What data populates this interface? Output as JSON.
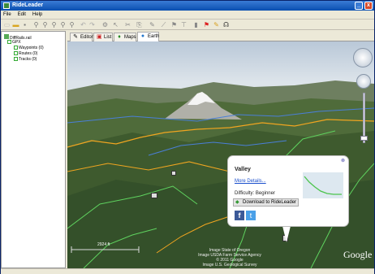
{
  "window": {
    "title": "RideLeader",
    "controls": [
      "_",
      "x"
    ]
  },
  "menu": [
    "File",
    "Edit",
    "Help"
  ],
  "toolbar_icons": [
    "new-icon",
    "open-icon",
    "save-icon",
    "zoom-in-icon",
    "zoom-out-icon",
    "zoom-fit-icon",
    "zoom-area-icon",
    "zoom-prev-icon",
    "undo-icon",
    "redo-icon",
    "gear-icon",
    "pointer-icon",
    "cut-icon",
    "copy-icon",
    "pencil-icon",
    "route-icon",
    "flag-icon",
    "pin-icon",
    "delete-icon",
    "red-flag-icon",
    "edit-icon",
    "headphones-icon"
  ],
  "tree": {
    "root": "DiffRails.rail",
    "child": "GPX",
    "items": [
      "Waypoints (0)",
      "Routes (0)",
      "Tracks (0)"
    ]
  },
  "tabs": [
    {
      "label": "Editor",
      "icon": "pencil-icon"
    },
    {
      "label": "List",
      "icon": "list-icon"
    },
    {
      "label": "Maps",
      "icon": "map-pin-icon"
    },
    {
      "label": "Earth",
      "icon": "globe-icon",
      "active": true
    }
  ],
  "popup": {
    "title": "Valley",
    "link": "More Details...",
    "difficulty": "Difficulty: Beginner",
    "download": "Download to RideLeader",
    "social": [
      "f"
    ]
  },
  "map": {
    "scale": "2924 ft",
    "attribution": [
      "Image State of Oregon",
      "Image USDA Farm Service Agency",
      "© 2011 Google",
      "Image U.S. Geological Survey"
    ],
    "logo": "Google"
  },
  "colors": {
    "track_yellow": "#f0a520",
    "track_blue": "#4a7fd8",
    "track_green": "#5fd35f",
    "popup_link": "#1a4fcc"
  }
}
